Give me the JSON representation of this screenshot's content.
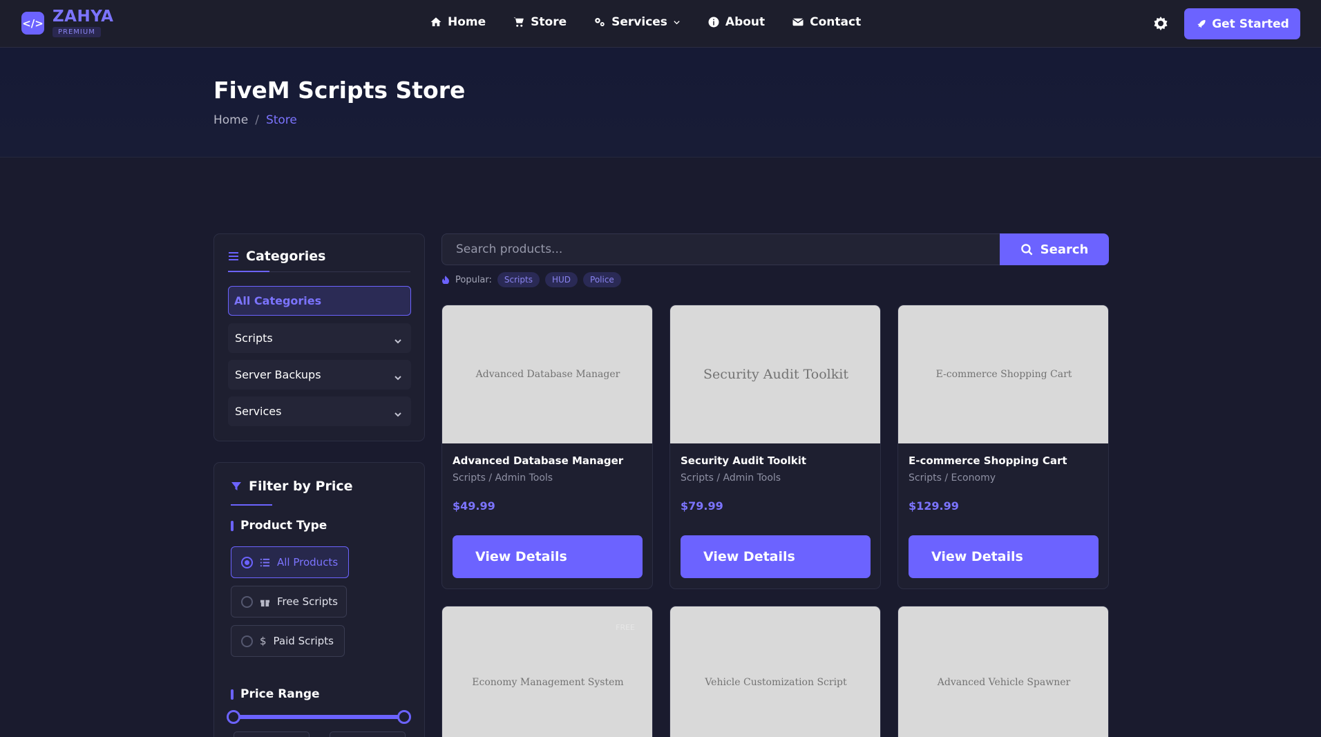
{
  "navbar": {
    "logo_glyph": "</>",
    "brand": "ZAHYA",
    "badge": "PREMIUM",
    "links": [
      {
        "label": "Home",
        "icon": "home-icon"
      },
      {
        "label": "Store",
        "icon": "cart-icon"
      },
      {
        "label": "Services",
        "icon": "gears-icon"
      },
      {
        "label": "About",
        "icon": "info-icon"
      },
      {
        "label": "Contact",
        "icon": "envelope-icon"
      }
    ],
    "cta_label": "Get Started"
  },
  "hero": {
    "title": "FiveM Scripts Store",
    "breadcrumb_home": "Home",
    "breadcrumb_sep": "/",
    "breadcrumb_current": "Store"
  },
  "categories": {
    "title": "Categories",
    "items": [
      {
        "label": "All Categories",
        "active": true
      },
      {
        "label": "Scripts"
      },
      {
        "label": "Server Backups"
      },
      {
        "label": "Services"
      }
    ]
  },
  "price_filter": {
    "title": "Filter by Price",
    "product_type_label": "Product Type",
    "types": [
      {
        "label": "All Products",
        "active": true
      },
      {
        "label": "Free Scripts"
      },
      {
        "label": "Paid Scripts"
      }
    ],
    "price_range_label": "Price Range"
  },
  "search": {
    "placeholder": "Search products...",
    "button_label": "Search",
    "popular_label": "Popular:",
    "tags": [
      "Scripts",
      "HUD",
      "Police"
    ]
  },
  "products": [
    {
      "thumb": "Advanced Database Manager",
      "title": "Advanced Database Manager",
      "category": "Scripts / Admin Tools",
      "price": "$49.99",
      "button": "View Details"
    },
    {
      "thumb": "Security Audit Toolkit",
      "title": "Security Audit Toolkit",
      "category": "Scripts / Admin Tools",
      "price": "$79.99",
      "button": "View Details"
    },
    {
      "thumb": "E-commerce Shopping Cart",
      "title": "E-commerce Shopping Cart",
      "category": "Scripts / Economy",
      "price": "$129.99",
      "button": "View Details"
    },
    {
      "thumb": "Economy Management System",
      "free_tag": "FREE"
    },
    {
      "thumb": "Vehicle Customization Script"
    },
    {
      "thumb": "Advanced Vehicle Spawner"
    }
  ],
  "colors": {
    "accent": "#6c63ff",
    "background": "#1a1b2e",
    "card": "#1e1f30"
  }
}
